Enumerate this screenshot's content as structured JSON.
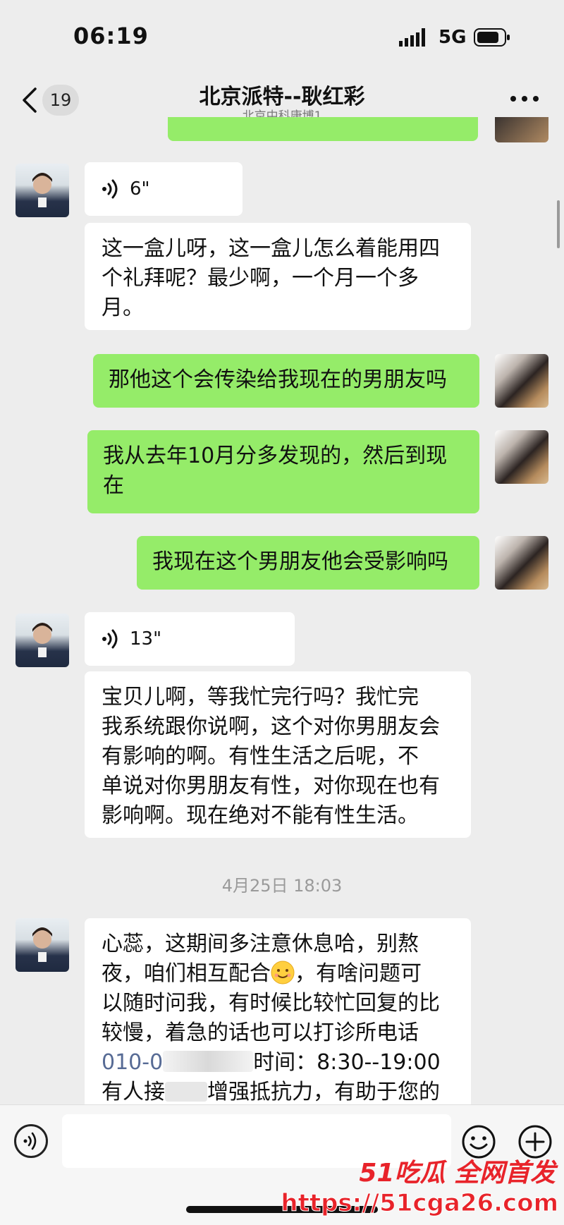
{
  "status_bar": {
    "time": "06:19",
    "network": "5G"
  },
  "header": {
    "back_badge": "19",
    "title": "北京派特--耿红彩",
    "subtitle": "北京中科康博1"
  },
  "messages": [
    {
      "side": "left",
      "kind": "voice",
      "duration": "6\""
    },
    {
      "side": "left",
      "kind": "text",
      "lines": [
        "这一盒儿呀，这一盒儿怎么着能用四",
        "个礼拜呢？最少啊，一个月一个多",
        "月。"
      ]
    },
    {
      "side": "right",
      "kind": "text",
      "lines": [
        "那他这个会传染给我现在的男朋友吗"
      ]
    },
    {
      "side": "right",
      "kind": "text",
      "lines": [
        "我从去年10月分多发现的，然后到现",
        "在"
      ]
    },
    {
      "side": "right",
      "kind": "text",
      "lines": [
        "我现在这个男朋友他会受影响吗"
      ]
    },
    {
      "side": "left",
      "kind": "voice",
      "duration": "13\""
    },
    {
      "side": "left",
      "kind": "text",
      "lines": [
        "宝贝儿啊，等我忙完行吗？我忙完",
        "我系统跟你说啊，这个对你男朋友会",
        "有影响的啊。有性生活之后呢，不",
        "单说对你男朋友有性，对你现在也有",
        "影响啊。现在绝对不能有性生活。"
      ]
    },
    {
      "side": "left",
      "kind": "text",
      "lines": [
        "心蕊，这期间多注意休息哈，别熬",
        "夜，咱们相互配合",
        "，有啥问题可",
        "以随时问我，有时候比较忙回复的比",
        "较慢，着急的话也可以打诊所电话",
        "010-0",
        "时间：8:30--19:00",
        "有人接",
        "增强抵抗力，有助于您的"
      ]
    }
  ],
  "timestamp": "4月25日 18:03",
  "input_bar": {
    "placeholder": ""
  },
  "watermark": {
    "logo": "51吃瓜 全网首发",
    "url": "https://51cga26.com"
  },
  "colors": {
    "self_bubble": "#95ec69",
    "other_bubble": "#ffffff",
    "background": "#ededed"
  },
  "icons": [
    "chevron-left-icon",
    "more-icon",
    "voice-wave-icon",
    "emoji-icon",
    "plus-icon",
    "signal-icon",
    "battery-icon"
  ]
}
